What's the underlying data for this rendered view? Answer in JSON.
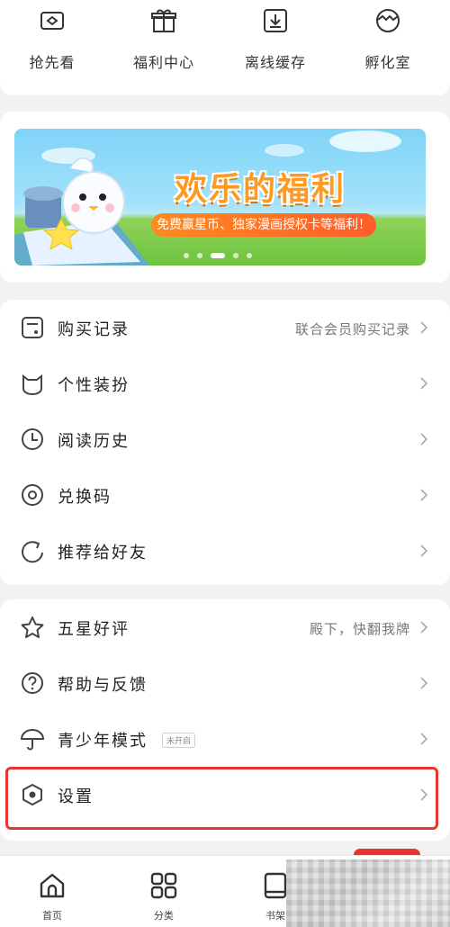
{
  "quick_actions": [
    {
      "label": "抢先看",
      "icon": "ticket-icon"
    },
    {
      "label": "福利中心",
      "icon": "gift-icon"
    },
    {
      "label": "离线缓存",
      "icon": "download-icon"
    },
    {
      "label": "孵化室",
      "icon": "egg-icon"
    }
  ],
  "banner": {
    "title": "欢乐的福利",
    "subtitle": "免费赢星币、独家漫画授权卡等福利！",
    "dot_count": 5,
    "active_dot": 2
  },
  "menu_group_1": [
    {
      "label": "购买记录",
      "extra": "联合会员购买记录",
      "icon": "purchase-record-icon"
    },
    {
      "label": "个性装扮",
      "extra": "",
      "icon": "cat-face-icon"
    },
    {
      "label": "阅读历史",
      "extra": "",
      "icon": "clock-icon"
    },
    {
      "label": "兑换码",
      "extra": "",
      "icon": "redeem-code-icon"
    },
    {
      "label": "推荐给好友",
      "extra": "",
      "icon": "share-icon"
    }
  ],
  "menu_group_2": [
    {
      "label": "五星好评",
      "extra": "殿下，快翻我牌",
      "icon": "star-icon"
    },
    {
      "label": "帮助与反馈",
      "extra": "",
      "icon": "help-icon"
    },
    {
      "label": "青少年模式",
      "extra": "",
      "badge": "未开启",
      "icon": "umbrella-icon"
    },
    {
      "label": "设置",
      "extra": "",
      "icon": "settings-icon"
    }
  ],
  "tabbar": [
    {
      "label": "首页",
      "icon": "home-icon"
    },
    {
      "label": "分类",
      "icon": "category-icon"
    },
    {
      "label": "书架",
      "icon": "bookshelf-icon"
    }
  ],
  "colors": {
    "highlight": "#e8342e",
    "banner_title": "#ff9a1f",
    "banner_sub": "#ff6a25"
  }
}
